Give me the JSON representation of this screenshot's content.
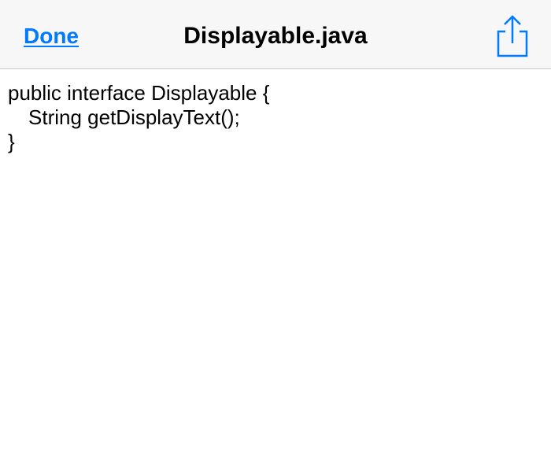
{
  "navbar": {
    "done_label": "Done",
    "title": "Displayable.java",
    "share_icon": "share-icon",
    "accent_color": "#007aff"
  },
  "file": {
    "lines": [
      "public interface Displayable {",
      "String getDisplayText();",
      "}"
    ]
  }
}
